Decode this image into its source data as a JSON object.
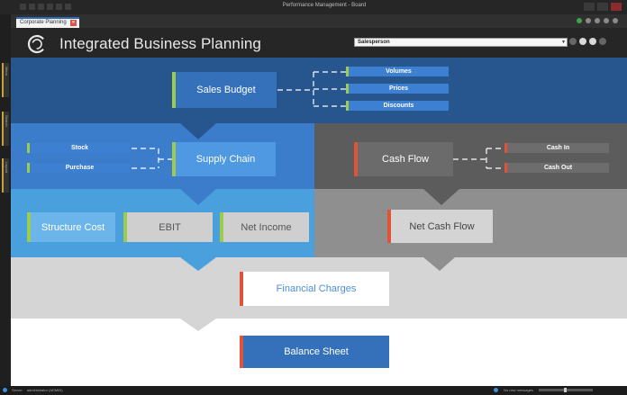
{
  "window": {
    "title": "Performance Management - Board",
    "tab_label": "Corporate Planning",
    "tab_close": "✕"
  },
  "app": {
    "title": "Integrated Business Planning",
    "selector_value": "Salesperson"
  },
  "left_rail": {
    "tabs": [
      "Menu",
      "Search",
      "Layout"
    ]
  },
  "diagram": {
    "sales_budget": "Sales Budget",
    "volumes": "Volumes",
    "prices": "Prices",
    "discounts": "Discounts",
    "stock": "Stock",
    "purchase": "Purchase",
    "supply_chain": "Supply Chain",
    "cash_flow": "Cash Flow",
    "cash_in": "Cash In",
    "cash_out": "Cash Out",
    "structure_cost": "Structure Cost",
    "ebit": "EBIT",
    "net_income": "Net Income",
    "net_cash_flow": "Net Cash Flow",
    "financial_charges": "Financial Charges",
    "balance_sheet": "Balance Sheet"
  },
  "status": {
    "left_label": "Server",
    "user": "administrator (ADMIN)",
    "right_label": "No new messages"
  },
  "colors": {
    "accent_green": "#9ccb4d",
    "accent_red": "#e0533b",
    "dark_blue": "#27568f",
    "mid_blue": "#3b7dcb",
    "light_blue": "#4aa0dd"
  }
}
